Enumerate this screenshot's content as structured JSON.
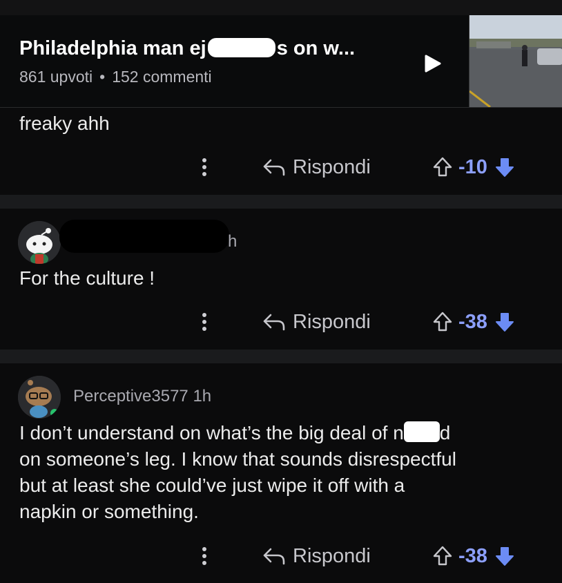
{
  "post": {
    "title_start": "Philadelphia man ej",
    "title_end": "s on w...",
    "upvotes": "861 upvoti",
    "comments": "152 commenti",
    "dot": "•"
  },
  "comments": [
    {
      "text": "freaky ahh",
      "reply_label": "Rispondi",
      "score": "-10"
    },
    {
      "partial_time": "h",
      "text": "For the culture !",
      "reply_label": "Rispondi",
      "score": "-38"
    },
    {
      "username": "Perceptive3577",
      "time": "1h",
      "text_line1_start": "I don’t understand on what’s the big deal of n",
      "text_line1_end": "d",
      "text_line2": "on someone’s leg. I know that sounds disrespectful",
      "text_line3": "but at least she could’ve just wipe it off with a",
      "text_line4": "napkin or something.",
      "reply_label": "Rispondi",
      "score": "-38"
    }
  ],
  "colors": {
    "background": "#0b0b0c",
    "separator": "#1a1b1d",
    "vote_accent": "#8c9ffb",
    "downvote_active": "#6c8cf5"
  },
  "icons": [
    "play-icon",
    "more-vertical-icon",
    "reply-icon",
    "upvote-icon",
    "downvote-icon"
  ]
}
